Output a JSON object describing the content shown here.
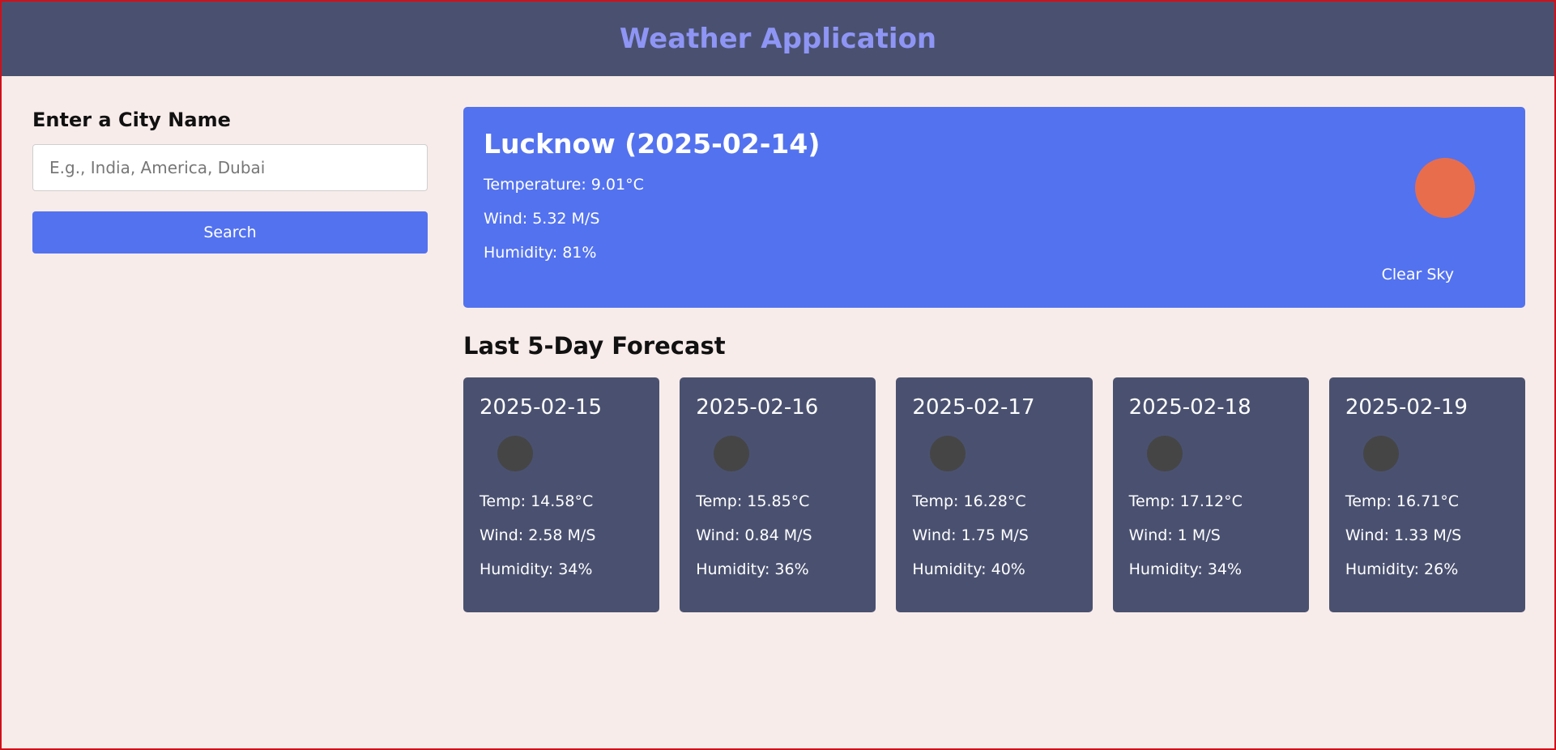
{
  "header": {
    "title": "Weather Application"
  },
  "sidebar": {
    "label": "Enter a City Name",
    "input_placeholder": "E.g., India, America, Dubai",
    "input_value": "",
    "search_label": "Search"
  },
  "current": {
    "title": "Lucknow (2025-02-14)",
    "temperature": "Temperature: 9.01°C",
    "wind": "Wind: 5.32 M/S",
    "humidity": "Humidity: 81%",
    "description": "Clear Sky",
    "icon": "sun-icon",
    "icon_color": "#e86d4d"
  },
  "forecast": {
    "heading": "Last 5-Day Forecast",
    "days": [
      {
        "date": "2025-02-15",
        "temp": "Temp: 14.58°C",
        "wind": "Wind: 2.58 M/S",
        "humidity": "Humidity: 34%",
        "icon": "weather-icon"
      },
      {
        "date": "2025-02-16",
        "temp": "Temp: 15.85°C",
        "wind": "Wind: 0.84 M/S",
        "humidity": "Humidity: 36%",
        "icon": "weather-icon"
      },
      {
        "date": "2025-02-17",
        "temp": "Temp: 16.28°C",
        "wind": "Wind: 1.75 M/S",
        "humidity": "Humidity: 40%",
        "icon": "weather-icon"
      },
      {
        "date": "2025-02-18",
        "temp": "Temp: 17.12°C",
        "wind": "Wind: 1 M/S",
        "humidity": "Humidity: 34%",
        "icon": "weather-icon"
      },
      {
        "date": "2025-02-19",
        "temp": "Temp: 16.71°C",
        "wind": "Wind: 1.33 M/S",
        "humidity": "Humidity: 26%",
        "icon": "weather-icon"
      }
    ]
  },
  "colors": {
    "header_bg": "#4a5170",
    "title": "#8e95f5",
    "accent": "#5372ef",
    "page_bg": "#f8ecea",
    "card_bg": "#4a5170"
  }
}
